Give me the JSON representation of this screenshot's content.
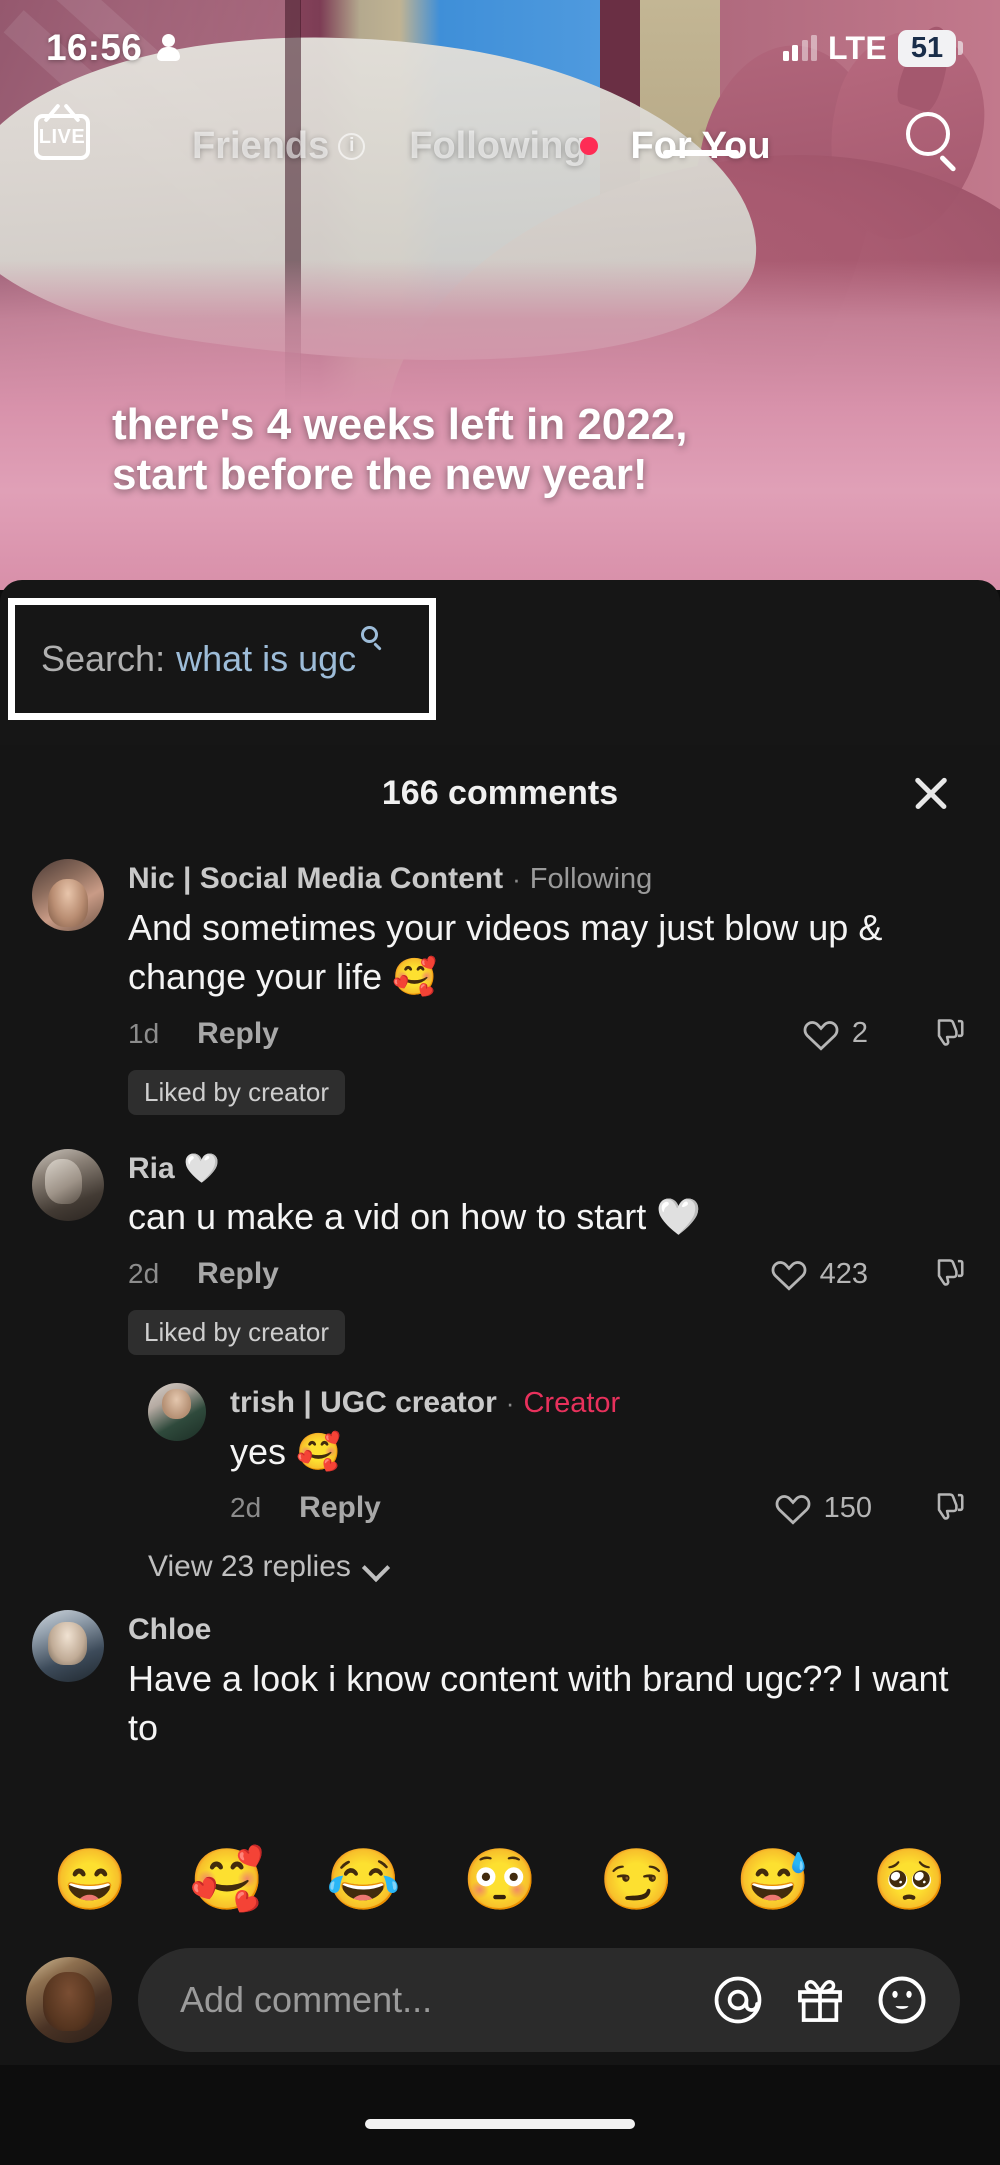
{
  "status_bar": {
    "time": "16:56",
    "person_icon": "person-icon",
    "network_label": "LTE",
    "battery_level": "51",
    "signal_icon": "signal-bars-icon"
  },
  "top_nav": {
    "live_label": "LIVE",
    "live_icon": "live-tv-icon",
    "tabs": [
      {
        "label": "Friends",
        "active": false,
        "has_info": true,
        "has_dot": false
      },
      {
        "label": "Following",
        "active": false,
        "has_info": false,
        "has_dot": true
      },
      {
        "label": "For You",
        "active": true,
        "has_info": false,
        "has_dot": false
      }
    ],
    "search_icon": "search-icon"
  },
  "video": {
    "caption_line1": "there's 4 weeks left in 2022,",
    "caption_line2": "start before the new year!"
  },
  "search_strip": {
    "label": "Search:",
    "query": "what is ugc",
    "icon": "search-icon"
  },
  "comments": {
    "header_title": "166 comments",
    "close_icon": "close-icon",
    "items": [
      {
        "avatar": "av1",
        "user": "Nic | Social Media Content",
        "separator": "·",
        "tag": "Following",
        "tag_type": "following",
        "text": "And sometimes your videos may just blow up & change your life 🥰",
        "time": "1d",
        "reply_label": "Reply",
        "like_count": "2",
        "liked_badge": "Liked by creator",
        "is_reply": false
      },
      {
        "avatar": "av2",
        "user": "Ria",
        "user_suffix": "🤍",
        "separator": "",
        "tag": "",
        "tag_type": "",
        "text": "can u make a vid on how to start 🤍",
        "time": "2d",
        "reply_label": "Reply",
        "like_count": "423",
        "liked_badge": "Liked by creator",
        "is_reply": false
      },
      {
        "avatar": "av3",
        "user": "trish | UGC creator",
        "separator": "·",
        "tag": "Creator",
        "tag_type": "creator",
        "text": "yes 🥰",
        "time": "2d",
        "reply_label": "Reply",
        "like_count": "150",
        "liked_badge": "",
        "is_reply": true
      }
    ],
    "view_replies_label": "View 23 replies",
    "view_replies_icon": "chevron-down-icon",
    "partial_comment": {
      "avatar": "av4",
      "user": "Chloe",
      "text": "Have a look i know content with brand ugc??  I want to"
    }
  },
  "emoji_bar": {
    "emojis": [
      "😄",
      "🥰",
      "😂",
      "😳",
      "😏",
      "😅",
      "🥺"
    ]
  },
  "input_bar": {
    "avatar": "me-avatar",
    "placeholder": "Add comment...",
    "mention_icon": "at-mention-icon",
    "gift_icon": "gift-icon",
    "emoji_icon": "emoji-face-icon"
  },
  "colors": {
    "accent_red": "#fe2c55",
    "creator_red": "#e8315c",
    "search_query_blue": "#9dbcd8",
    "panel_bg": "#151515"
  }
}
